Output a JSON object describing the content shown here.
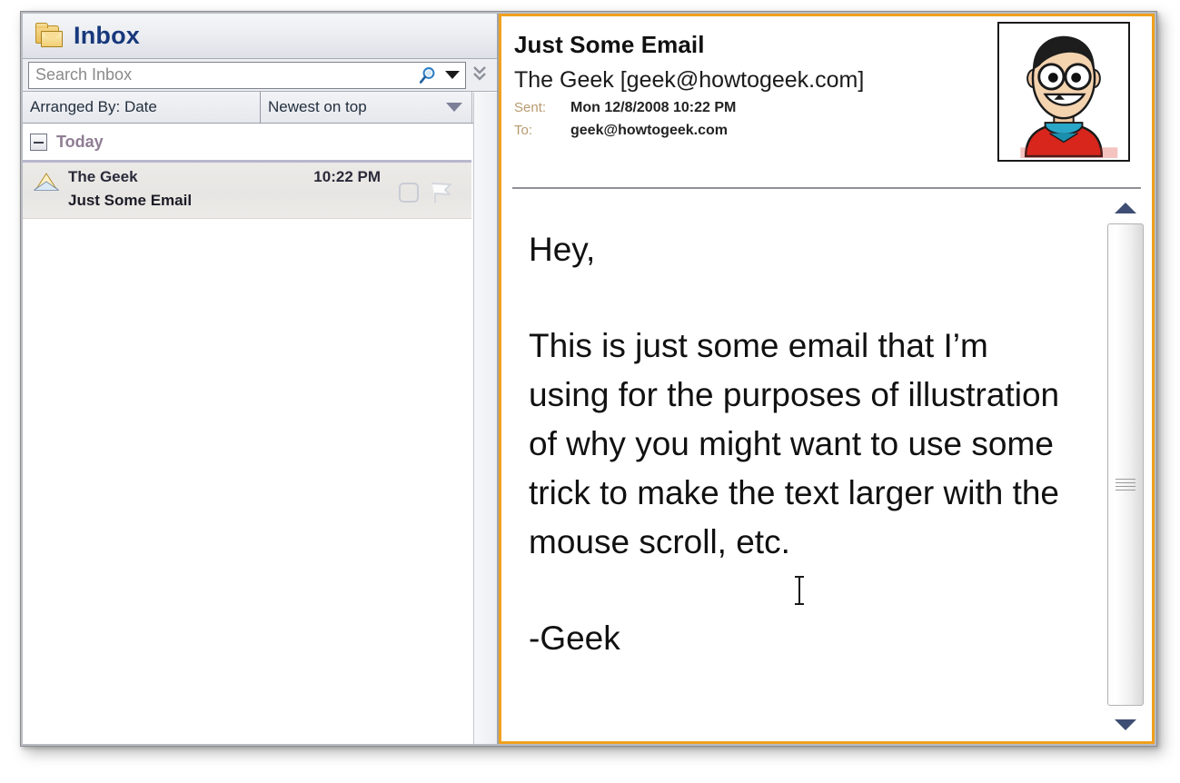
{
  "window": {
    "accent_orange": "#f0a11e",
    "title_blue": "#17387c"
  },
  "left_pane": {
    "folder_icon": "folder-mail-icon",
    "title": "Inbox",
    "search": {
      "placeholder": "Search Inbox",
      "value": "",
      "search_icon": "search-icon",
      "dropdown_icon": "chevron-down-icon",
      "expand_icon": "double-chevron-down-icon"
    },
    "arrange_bar": {
      "arranged_by": "Arranged By: Date",
      "sort_order": "Newest on top",
      "sort_dropdown_icon": "chevron-down-icon",
      "scroll_top_icon": "chevron-up-icon"
    },
    "groups": [
      {
        "label": "Today",
        "collapse_icon": "collapse-minus-icon",
        "messages": [
          {
            "status_icon": "opened-envelope-icon",
            "from": "The Geek",
            "time": "10:22 PM",
            "subject": "Just Some Email",
            "category_icon": "category-square-icon",
            "flag_icon": "flag-icon"
          }
        ]
      }
    ]
  },
  "reading_pane": {
    "subject": "Just Some Email",
    "sender": "The Geek [geek@howtogeek.com]",
    "sent_label": "Sent:",
    "sent_value": "Mon 12/8/2008 10:22 PM",
    "to_label": "To:",
    "to_value": "geek@howtogeek.com",
    "avatar": "geek-cartoon-avatar",
    "body_paragraphs": [
      "Hey,",
      "This is just some email that I’m using for the purposes of illustration of why you might want to use some trick to make the text larger with the mouse scroll, etc.",
      "-Geek"
    ],
    "scrollbar": {
      "up_icon": "chevron-up-icon",
      "down_icon": "chevron-down-icon",
      "grip_icon": "scrollbar-grip-icon"
    },
    "cursor_icon": "text-ibeam-cursor"
  }
}
